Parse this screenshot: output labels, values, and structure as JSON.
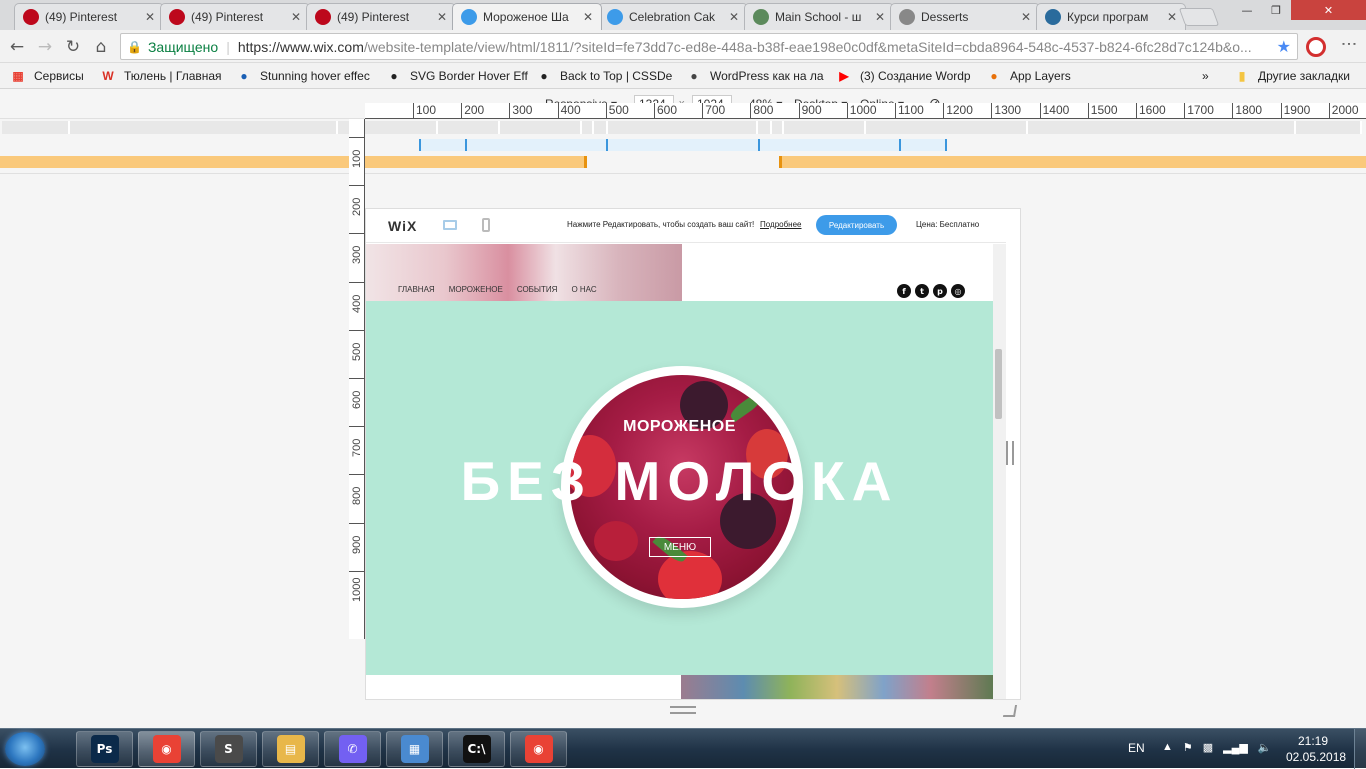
{
  "browser": {
    "tabs": [
      {
        "title": "(49) Pinterest",
        "icon": "pinterest-icon",
        "color": "#bd081c"
      },
      {
        "title": "(49) Pinterest",
        "icon": "pinterest-icon",
        "color": "#bd081c"
      },
      {
        "title": "(49) Pinterest",
        "icon": "pinterest-icon",
        "color": "#bd081c"
      },
      {
        "title": "Мороженое Ша",
        "icon": "wix-icon",
        "color": "#3d9be9",
        "active": true
      },
      {
        "title": "Celebration Cak",
        "icon": "wix-icon",
        "color": "#3d9be9"
      },
      {
        "title": "Main School - ш",
        "icon": "globe-icon",
        "color": "#5c8a5c"
      },
      {
        "title": "Desserts",
        "icon": "document-icon",
        "color": "#888888"
      },
      {
        "title": "Курси програм",
        "icon": "site-icon",
        "color": "#2a6b9c"
      }
    ],
    "window_buttons": {
      "minimize": "—",
      "maximize": "❐",
      "close": "✕"
    },
    "address": {
      "secure_label": "Защищено",
      "url_host": "https://www.wix.com",
      "url_path": "/website-template/view/html/1811/?siteId=fe73dd7c-ed8e-448a-b38f-eae198e0c0df&metaSiteId=cbda8964-548c-4537-b824-6fc28d7c124b&o..."
    },
    "bookmarks": [
      {
        "label": "Сервисы",
        "icon": "apps-icon",
        "color": "#e94235"
      },
      {
        "label": "Тюлень | Главная",
        "icon": "w-icon",
        "color": "#d93025"
      },
      {
        "label": "Stunning hover effec",
        "icon": "codepen-icon",
        "color": "#1a5fb4"
      },
      {
        "label": "SVG Border Hover Eff",
        "icon": "codepen-icon",
        "color": "#222222"
      },
      {
        "label": "Back to Top | CSSDe",
        "icon": "cssdeck-icon",
        "color": "#222222"
      },
      {
        "label": "WordPress как на ла",
        "icon": "wordpress-icon",
        "color": "#444444"
      },
      {
        "label": "(3) Создание Wordp",
        "icon": "youtube-icon",
        "color": "#ff0000"
      },
      {
        "label": "App Layers",
        "icon": "applayers-icon",
        "color": "#e8710a"
      }
    ],
    "bookmarks_more": "»",
    "other_bookmarks": "Другие закладки"
  },
  "editor": {
    "responsive_label": "Responsive",
    "width": "1324",
    "height": "1024",
    "times": "x",
    "zoom": "48%",
    "device": "Desktop",
    "network": "Online",
    "ruler_h": [
      "100",
      "200",
      "300",
      "400",
      "500",
      "600",
      "700",
      "800",
      "900",
      "1000",
      "1100",
      "1200",
      "1300",
      "1400",
      "1500",
      "1600",
      "1700",
      "1800",
      "1900",
      "2000"
    ],
    "ruler_v": [
      "100",
      "200",
      "300",
      "400",
      "500",
      "600",
      "700",
      "800",
      "900",
      "1000"
    ]
  },
  "wix_bar": {
    "logo": "WiX",
    "message": "Нажмите Редактировать, чтобы создать ваш сайт!",
    "more_link": "Подробнее",
    "edit_button": "Редактировать",
    "price": "Цена: Бесплатно"
  },
  "site": {
    "nav": [
      "ГЛАВНАЯ",
      "МОРОЖЕНОЕ",
      "СОБЫТИЯ",
      "О НАС"
    ],
    "socials": [
      "f",
      "t",
      "p",
      "◎"
    ],
    "hero_small": "МОРОЖЕНОЕ",
    "hero_big": "БЕЗ МОЛОКА",
    "hero_button": "МЕНЮ",
    "hero_bg": "#b4e8d6"
  },
  "taskbar": {
    "apps": [
      {
        "name": "photoshop",
        "glyph": "Ps",
        "color": "#0b2a4a"
      },
      {
        "name": "chrome",
        "glyph": "◉",
        "color": "#e94235"
      },
      {
        "name": "sublime",
        "glyph": "S",
        "color": "#4a4a4a"
      },
      {
        "name": "explorer",
        "glyph": "▤",
        "color": "#e8b74a"
      },
      {
        "name": "viber",
        "glyph": "✆",
        "color": "#7360f2"
      },
      {
        "name": "control-panel",
        "glyph": "▦",
        "color": "#4a8ad0"
      },
      {
        "name": "cmd",
        "glyph": "C:\\",
        "color": "#111111"
      },
      {
        "name": "chrome-2",
        "glyph": "◉",
        "color": "#e94235"
      }
    ],
    "language": "EN",
    "time": "21:19",
    "date": "02.05.2018"
  }
}
